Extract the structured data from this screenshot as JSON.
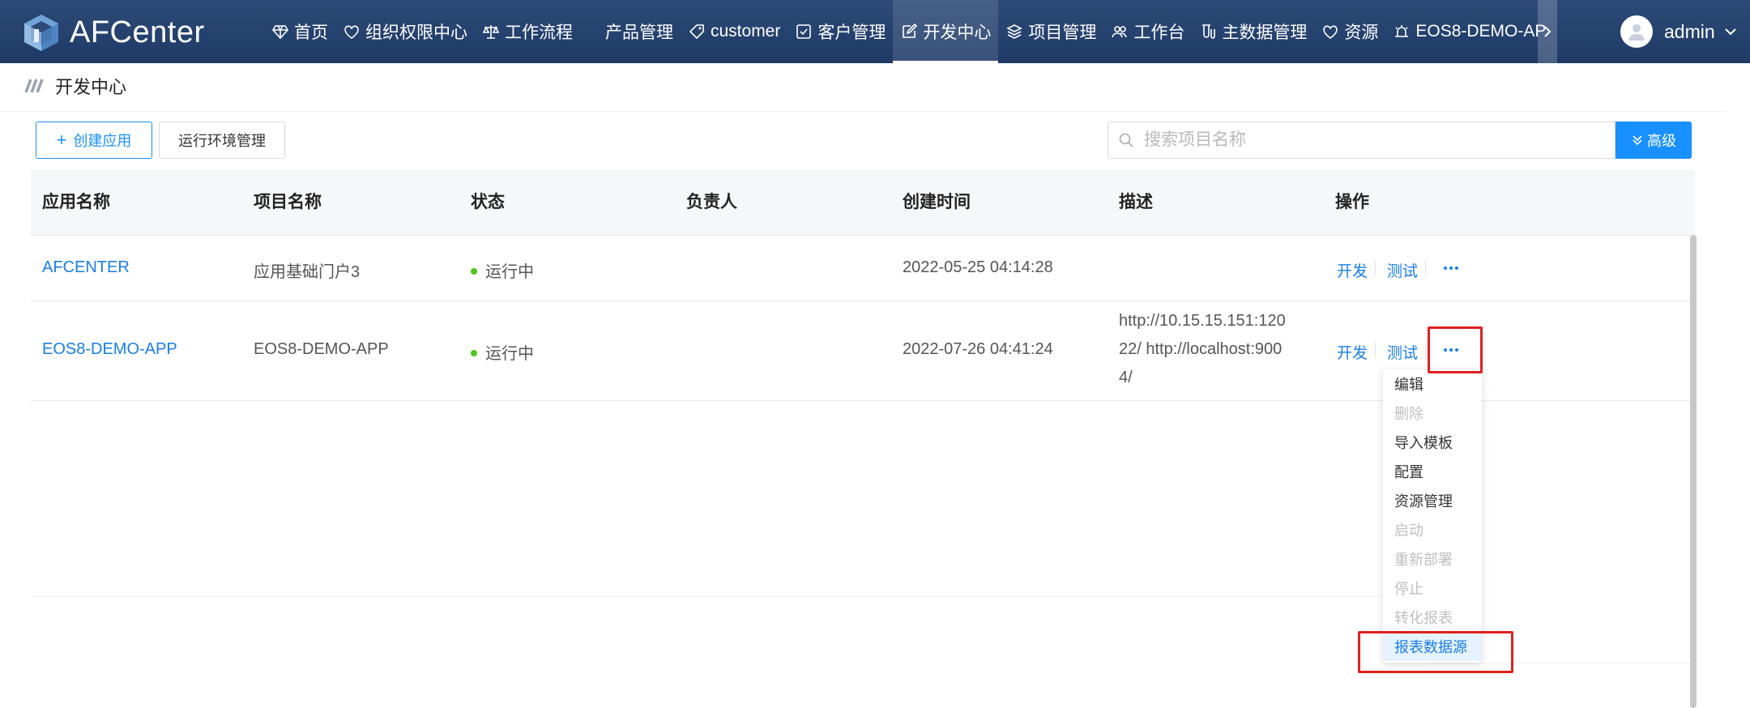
{
  "app": {
    "logo_text": "AFCenter"
  },
  "nav": {
    "items": [
      {
        "label": "首页",
        "icon": "diamond-icon"
      },
      {
        "label": "组织权限中心",
        "icon": "heart-icon"
      },
      {
        "label": "工作流程",
        "icon": "balance-icon"
      },
      {
        "label": "产品管理",
        "icon": ""
      },
      {
        "label": "customer",
        "icon": "tag-icon"
      },
      {
        "label": "客户管理",
        "icon": "checkbox-icon"
      },
      {
        "label": "开发中心",
        "icon": "edit-icon",
        "active": true
      },
      {
        "label": "项目管理",
        "icon": "layers-icon"
      },
      {
        "label": "工作台",
        "icon": "people-icon"
      },
      {
        "label": "主数据管理",
        "icon": "experiment-icon"
      },
      {
        "label": "资源",
        "icon": "heart-icon"
      },
      {
        "label": "EOS8-DEMO-AP",
        "icon": "alert-icon"
      }
    ]
  },
  "user": {
    "name": "admin"
  },
  "breadcrumb": {
    "title": "开发中心"
  },
  "toolbar": {
    "create_label": "创建应用",
    "env_label": "运行环境管理",
    "search_placeholder": "搜索项目名称",
    "advanced_label": "高级"
  },
  "table": {
    "columns": [
      "应用名称",
      "项目名称",
      "状态",
      "负责人",
      "创建时间",
      "描述",
      "操作"
    ],
    "rows": [
      {
        "app_name": "AFCENTER",
        "project_name": "应用基础门户3",
        "status": "运行中",
        "owner": "",
        "created": "2022-05-25 04:14:28",
        "desc_lines": [
          "",
          "",
          ""
        ],
        "ops": [
          "开发",
          "测试"
        ]
      },
      {
        "app_name": "EOS8-DEMO-APP",
        "project_name": "EOS8-DEMO-APP",
        "status": "运行中",
        "owner": "",
        "created": "2022-07-26 04:41:24",
        "desc_lines": [
          "http://10.15.15.151:120",
          "22/ http://localhost:900",
          "4/"
        ],
        "ops": [
          "开发",
          "测试"
        ]
      }
    ]
  },
  "dropdown": {
    "items": [
      {
        "label": "编辑",
        "disabled": false
      },
      {
        "label": "删除",
        "disabled": true
      },
      {
        "label": "导入模板",
        "disabled": false
      },
      {
        "label": "配置",
        "disabled": false
      },
      {
        "label": "资源管理",
        "disabled": false
      },
      {
        "label": "启动",
        "disabled": true
      },
      {
        "label": "重新部署",
        "disabled": true
      },
      {
        "label": "停止",
        "disabled": true
      },
      {
        "label": "转化报表",
        "disabled": true
      },
      {
        "label": "报表数据源",
        "disabled": false,
        "hover": true
      }
    ]
  },
  "colors": {
    "nav_bg": "#1f3a66",
    "accent": "#1890ff",
    "link": "#1a7ee6",
    "status_running": "#52c41a",
    "highlight": "#e02020"
  }
}
